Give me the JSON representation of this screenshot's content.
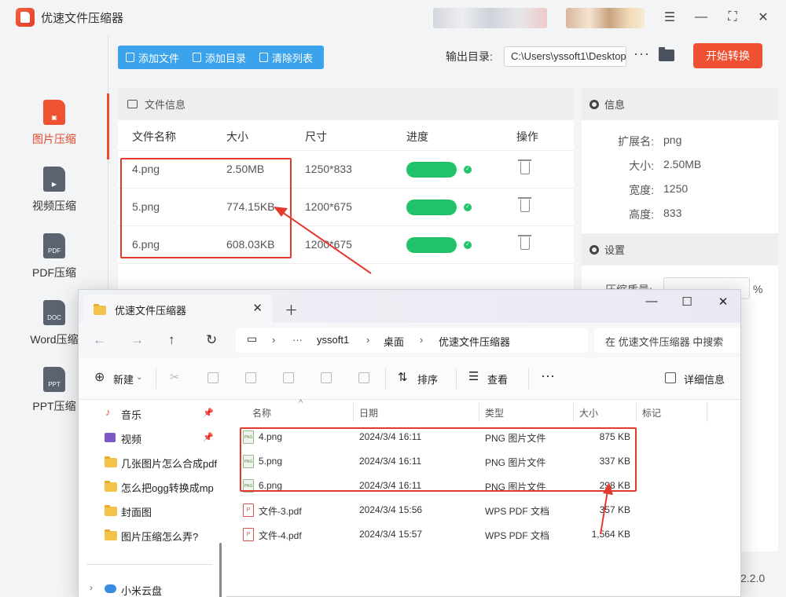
{
  "app": {
    "title": "优速文件压缩器",
    "version": "2.2.0"
  },
  "window_controls": [
    "menu-icon",
    "minimize-icon",
    "maximize-icon",
    "close-icon"
  ],
  "sidebar": {
    "items": [
      {
        "label": "图片压缩",
        "icon": "image-file-icon",
        "active": true
      },
      {
        "label": "视频压缩",
        "icon": "video-file-icon",
        "active": false
      },
      {
        "label": "PDF压缩",
        "icon": "pdf-file-icon",
        "badge": "PDF",
        "active": false
      },
      {
        "label": "Word压缩",
        "icon": "doc-file-icon",
        "badge": "DOC",
        "active": false
      },
      {
        "label": "PPT压缩",
        "icon": "ppt-file-icon",
        "badge": "PPT",
        "active": false
      }
    ]
  },
  "toolbar": {
    "add_file": "添加文件",
    "add_dir": "添加目录",
    "clear_list": "清除列表",
    "output_label": "输出目录:",
    "output_path": "C:\\Users\\yssoft1\\Desktop",
    "more": "···",
    "start": "开始转换"
  },
  "file_panel": {
    "title": "文件信息",
    "columns": [
      "文件名称",
      "大小",
      "尺寸",
      "进度",
      "操作"
    ],
    "rows": [
      {
        "name": "4.png",
        "size": "2.50MB",
        "dims": "1250*833",
        "progress": 1.0
      },
      {
        "name": "5.png",
        "size": "774.15KB",
        "dims": "1200*675",
        "progress": 1.0
      },
      {
        "name": "6.png",
        "size": "608.03KB",
        "dims": "1200*675",
        "progress": 1.0
      }
    ]
  },
  "info_panel": {
    "title": "信息",
    "fields": [
      {
        "key": "扩展名:",
        "value": "png"
      },
      {
        "key": "大小:",
        "value": "2.50MB"
      },
      {
        "key": "宽度:",
        "value": "1250"
      },
      {
        "key": "高度:",
        "value": "833"
      }
    ]
  },
  "settings_panel": {
    "title": "设置",
    "quality_label": "压缩质量:",
    "unit": "%"
  },
  "explorer": {
    "tab_title": "优速文件压缩器",
    "breadcrumb": [
      "yssoft1",
      "桌面",
      "优速文件压缩器"
    ],
    "search_placeholder": "在 优速文件压缩器 中搜索",
    "commands": {
      "new": "新建",
      "sort": "排序",
      "view": "查看",
      "details": "详细信息"
    },
    "nav": [
      {
        "label": "音乐",
        "pinned": true
      },
      {
        "label": "视频",
        "pinned": true
      },
      {
        "label": "几张图片怎么合成pdf"
      },
      {
        "label": "怎么把ogg转换成mp"
      },
      {
        "label": "封面图"
      },
      {
        "label": "图片压缩怎么弄?"
      },
      {
        "label": "小米云盘"
      }
    ],
    "columns": [
      "名称",
      "日期",
      "类型",
      "大小",
      "标记"
    ],
    "files": [
      {
        "name": "4.png",
        "date": "2024/3/4 16:11",
        "type": "PNG 图片文件",
        "size": "875 KB",
        "icon": "png"
      },
      {
        "name": "5.png",
        "date": "2024/3/4 16:11",
        "type": "PNG 图片文件",
        "size": "337 KB",
        "icon": "png"
      },
      {
        "name": "6.png",
        "date": "2024/3/4 16:11",
        "type": "PNG 图片文件",
        "size": "298 KB",
        "icon": "png"
      },
      {
        "name": "文件-3.pdf",
        "date": "2024/3/4 15:56",
        "type": "WPS PDF 文档",
        "size": "357 KB",
        "icon": "pdf"
      },
      {
        "name": "文件-4.pdf",
        "date": "2024/3/4 15:57",
        "type": "WPS PDF 文档",
        "size": "1,564 KB",
        "icon": "pdf"
      }
    ]
  },
  "colors": {
    "accent": "#ef5032",
    "blue": "#3aa3ec",
    "progress": "#21c26a",
    "highlight": "#e23a2f"
  }
}
